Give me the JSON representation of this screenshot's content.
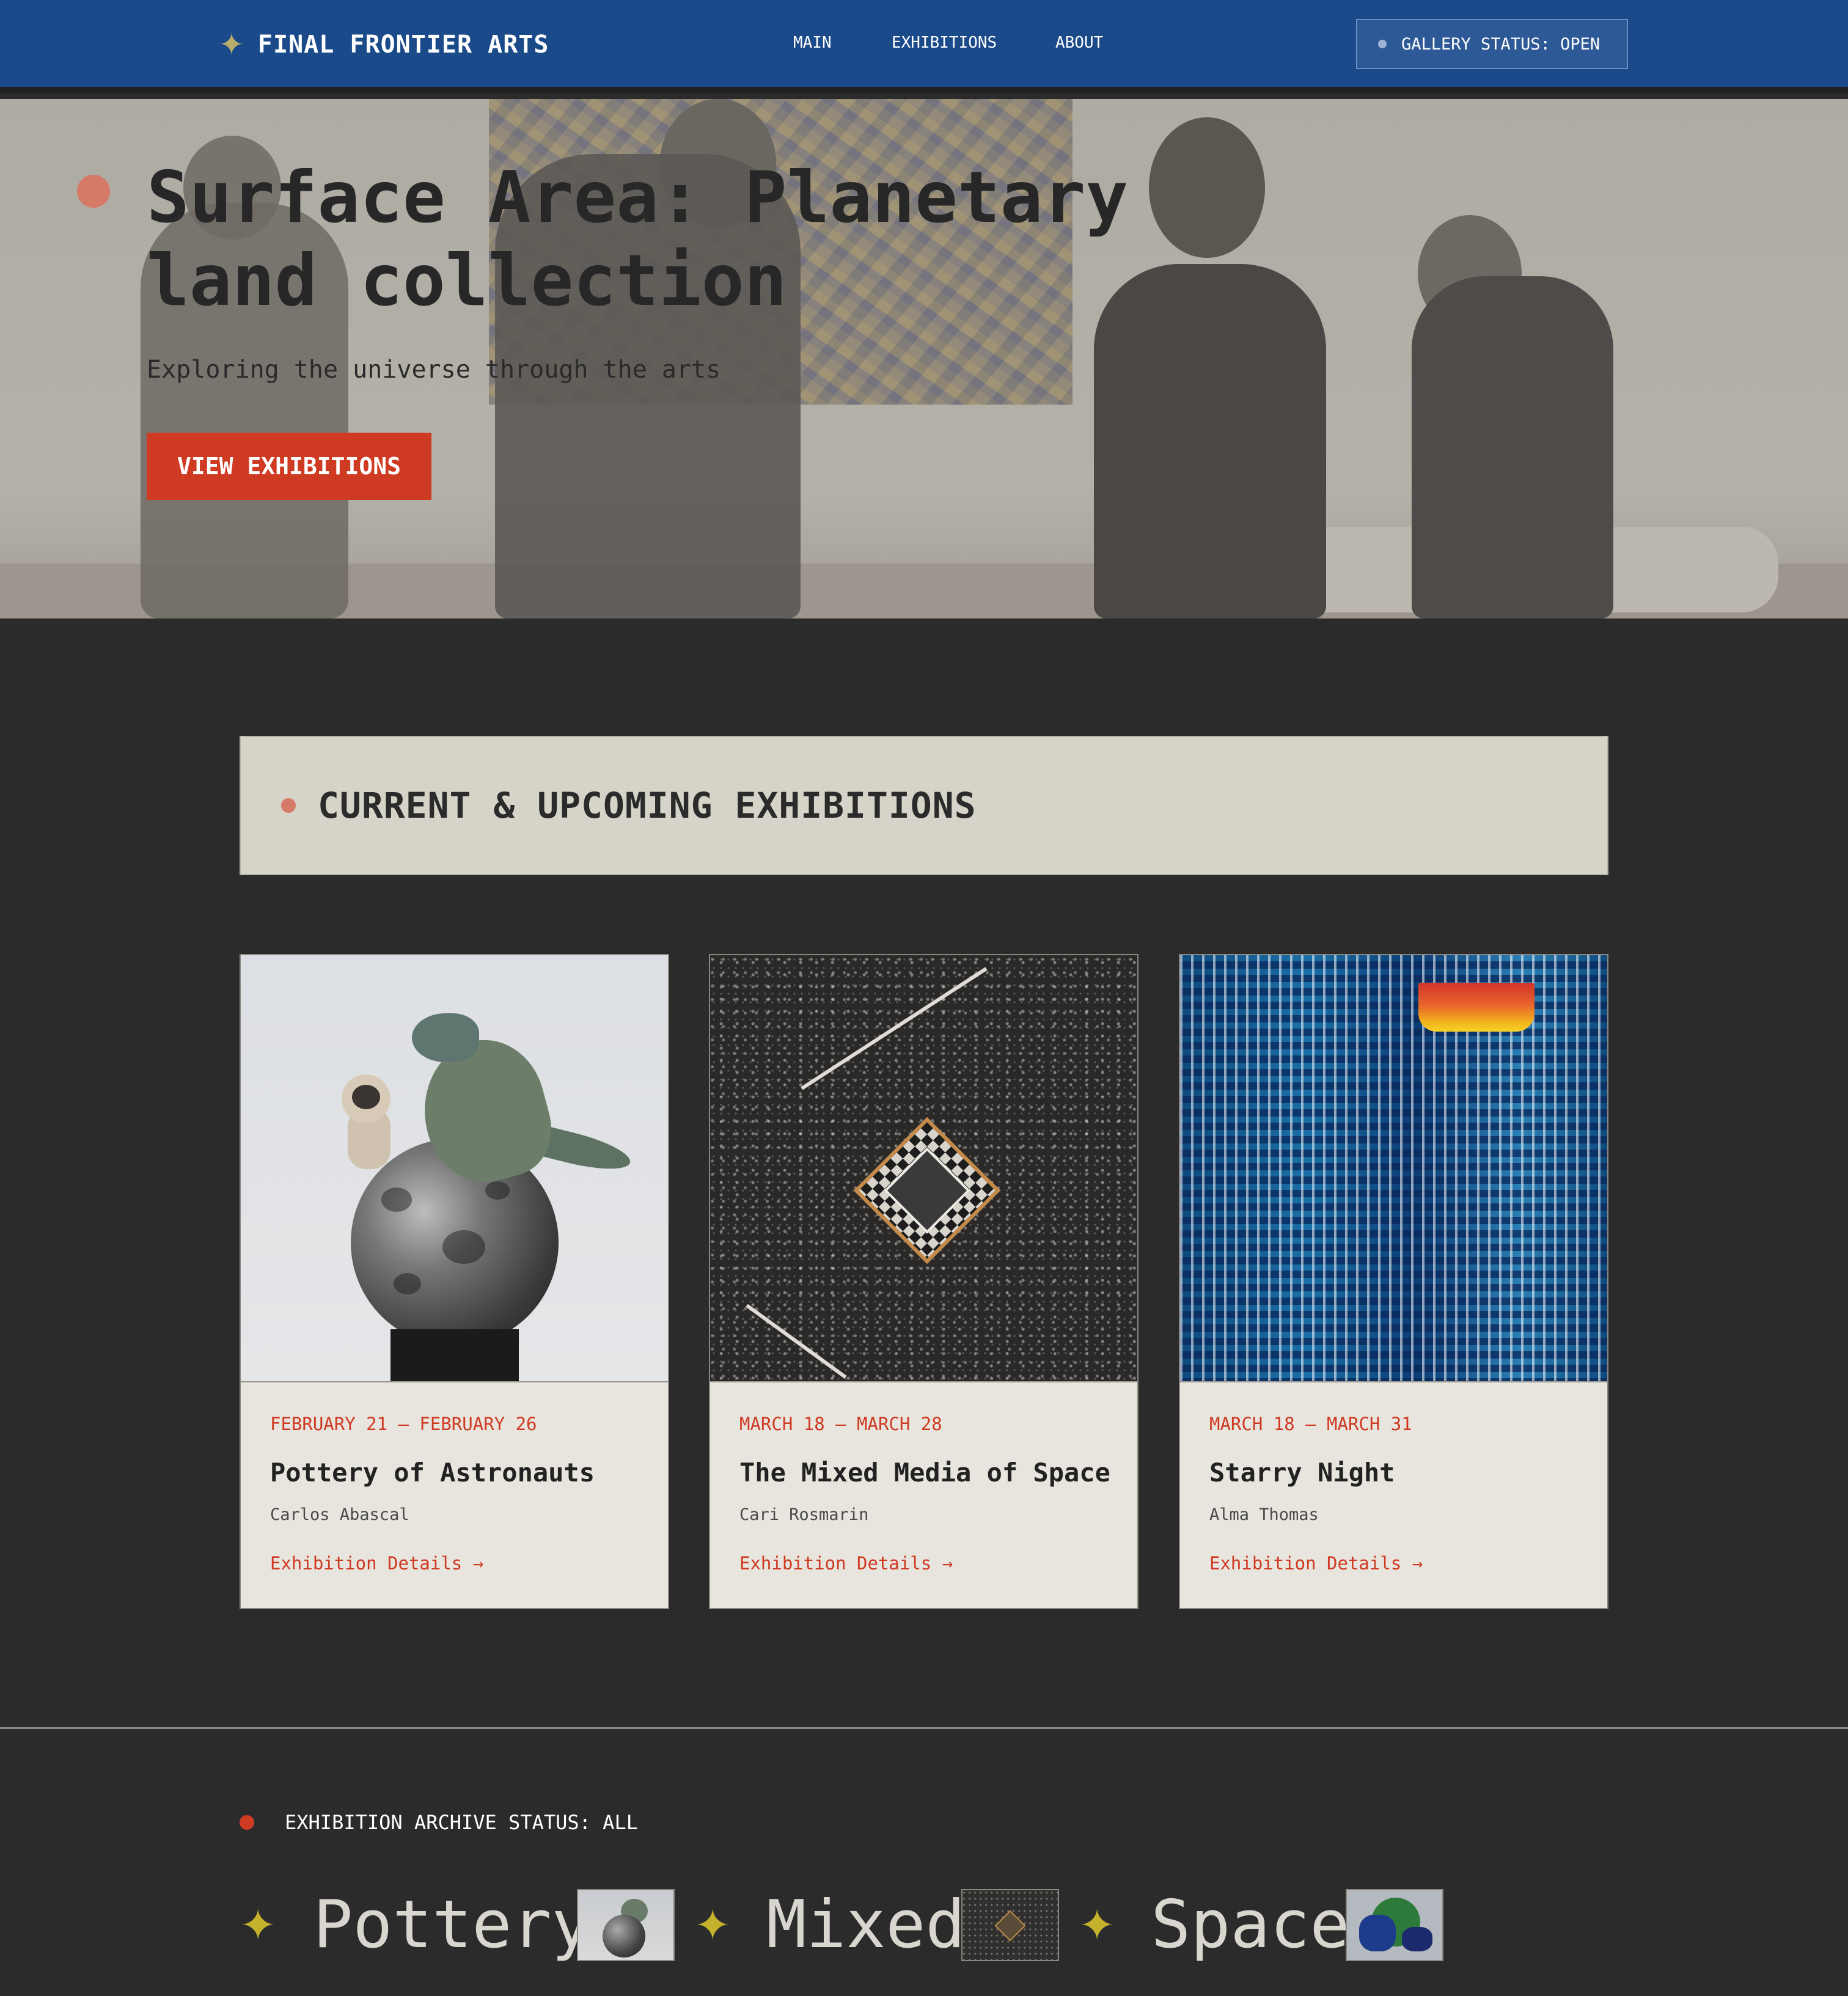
{
  "header": {
    "logo_icon": "sparkle-star-icon",
    "logo_text": "FINAL FRONTIER ARTS",
    "nav": [
      "MAIN",
      "EXHIBITIONS",
      "ABOUT"
    ],
    "status_label": "GALLERY STATUS: OPEN"
  },
  "hero": {
    "title": "Surface Area: Planetary land collection",
    "subtitle": "Exploring the universe through the arts",
    "cta_label": "VIEW EXHIBITIONS"
  },
  "section": {
    "title": "CURRENT & UPCOMING EXHIBITIONS"
  },
  "exhibitions": [
    {
      "date": "FEBRUARY 21 – FEBRUARY 26",
      "title": "Pottery of Astronauts",
      "artist": "Carlos Abascal",
      "link": "Exhibition Details →"
    },
    {
      "date": "MARCH 18 – MARCH 28",
      "title": "The Mixed Media of Space",
      "artist": "Cari Rosmarin",
      "link": "Exhibition Details →"
    },
    {
      "date": "MARCH 18 – MARCH 31",
      "title": "Starry Night",
      "artist": "Alma Thomas",
      "link": "Exhibition Details →"
    }
  ],
  "archive": {
    "status": "EXHIBITION ARCHIVE STATUS: ALL",
    "ticker": [
      "Pottery",
      "Mixed",
      "Space"
    ],
    "ticker_icon": "sparkle-star-icon"
  },
  "colors": {
    "header_bg": "#1a4a8a",
    "accent_red": "#cf3a22",
    "page_bg": "#2b2b2b",
    "panel_bg": "#d6d3c8",
    "card_bg": "#e8e5de",
    "star_gold": "#c4b22c"
  }
}
